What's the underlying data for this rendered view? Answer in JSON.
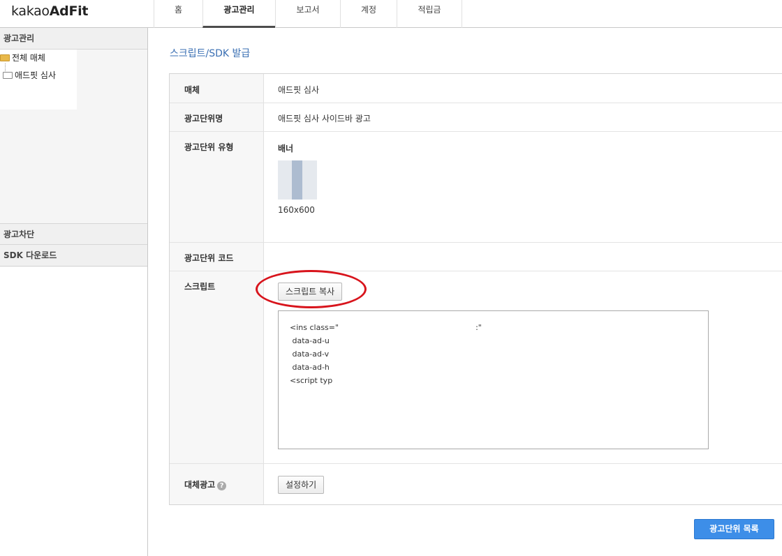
{
  "header": {
    "logo_light": "kakao",
    "logo_bold": "AdFit",
    "nav": [
      {
        "label": "홈"
      },
      {
        "label": "광고관리"
      },
      {
        "label": "보고서"
      },
      {
        "label": "계정"
      },
      {
        "label": "적립금"
      }
    ],
    "active_nav": "광고관리"
  },
  "sidebar": {
    "section_ad_manage": "광고관리",
    "tree": [
      {
        "label": "전체 매체",
        "icon": "folder-open-icon"
      },
      {
        "label": "애드핏 심사",
        "icon": "folder-icon"
      }
    ],
    "section_block": "광고차단",
    "section_sdk": "SDK 다운로드"
  },
  "main": {
    "title": "스크립트/SDK 발급",
    "rows": {
      "media_label": "매체",
      "media_value": "애드핏 심사",
      "unit_name_label": "광고단위명",
      "unit_name_value": "애드핏 심사 사이드바 광고",
      "unit_type_label": "광고단위 유형",
      "unit_type_value": "배너",
      "banner_size": "160x600",
      "unit_code_label": "광고단위 코드",
      "script_label": "스크립트",
      "copy_button": "스크립트 복사",
      "script_lines": [
        "<ins class=\"",
        " data-ad-u",
        " data-ad-v",
        " data-ad-h",
        "<script typ"
      ],
      "script_line1_tail": ":\"",
      "fallback_label": "대체광고",
      "fallback_help_icon": "question-circle-icon",
      "setup_button": "설정하기"
    },
    "list_button": "광고단위 목록"
  },
  "colors": {
    "title_blue": "#3a6fb3",
    "primary_button": "#3d8ee8",
    "annotation_red": "#d8141c"
  }
}
